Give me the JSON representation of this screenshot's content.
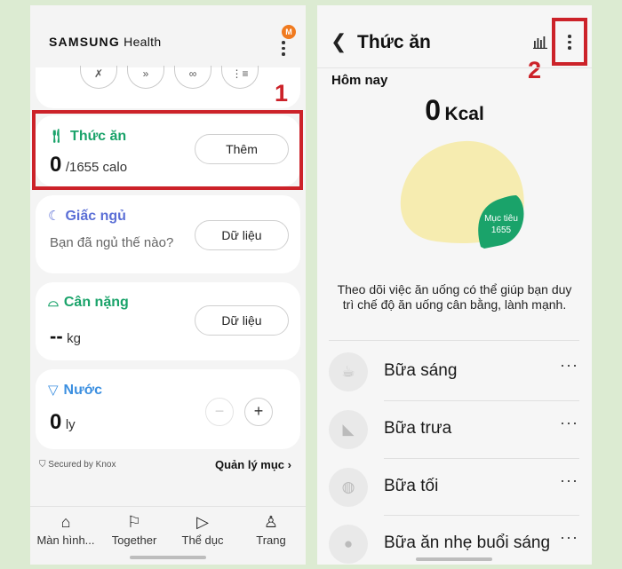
{
  "left": {
    "brand_part1": "SAMSUNG",
    "brand_part2": "Health",
    "badge": "M",
    "top_icons": [
      "✗",
      "»",
      "∞",
      "⋮≡"
    ],
    "food": {
      "title": "Thức ăn",
      "value": "0",
      "unit": "/1655 calo",
      "button": "Thêm"
    },
    "sleep": {
      "title": "Giấc ngủ",
      "subtitle": "Bạn đã ngủ thế nào?",
      "button": "Dữ liệu"
    },
    "weight": {
      "title": "Cân nặng",
      "value": "--",
      "unit": "kg",
      "button": "Dữ liệu"
    },
    "water": {
      "title": "Nước",
      "value": "0",
      "unit": "ly",
      "minus": "−",
      "plus": "+"
    },
    "secured": "Secured by Knox",
    "manage": "Quản lý mục ›",
    "nav": [
      {
        "label": "Màn hình..."
      },
      {
        "label": "Together"
      },
      {
        "label": "Thể dục"
      },
      {
        "label": "Trang"
      }
    ],
    "annotation": "1"
  },
  "right": {
    "title": "Thức ăn",
    "today": "Hôm nay",
    "kcal_value": "0",
    "kcal_unit": "Kcal",
    "goal_label": "Mục tiêu",
    "goal_value": "1655",
    "description": "Theo dõi việc ăn uống có thể giúp bạn duy trì chế độ ăn uống cân bằng, lành mạnh.",
    "meals": [
      "Bữa sáng",
      "Bữa trưa",
      "Bữa tối",
      "Bữa ăn nhẹ buổi sáng"
    ],
    "annotation": "2"
  },
  "colors": {
    "green": "#1aa36a",
    "sleep_blue": "#5b6fd6",
    "water_blue": "#3b8fe0",
    "highlight_red": "#cc2229",
    "lemon": "#f6ecb0"
  }
}
